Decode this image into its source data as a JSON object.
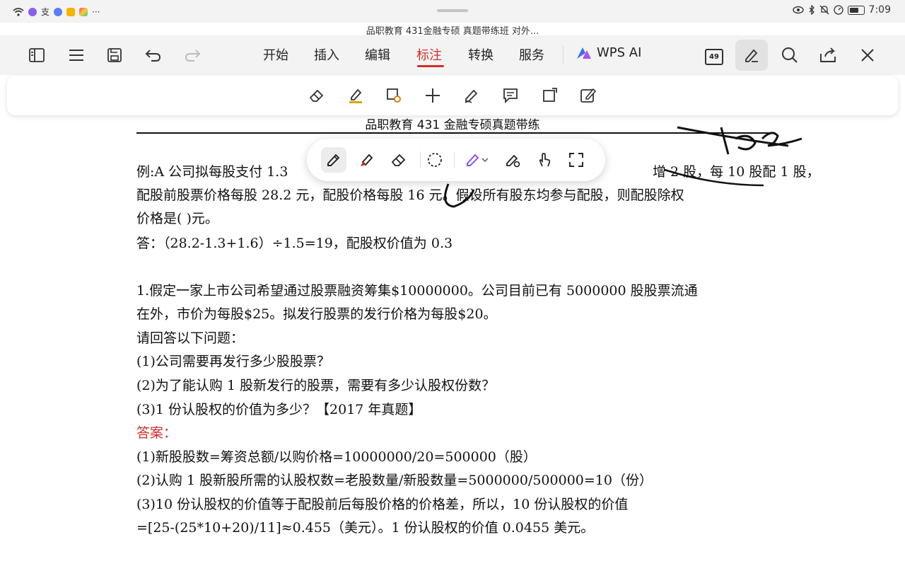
{
  "status": {
    "time": "7:09",
    "left_icons": [
      "wifi-icon",
      "app-icon-purple",
      "alipay-icon",
      "app-icon-blue",
      "app-icon-yellow",
      "gallery-icon",
      "more-dots-icon"
    ],
    "more_dots": "···"
  },
  "doc_title": "品职教育 431金融专硕 真题带练班 对外...",
  "toolbar": {
    "tabs": [
      "开始",
      "插入",
      "编辑",
      "标注",
      "转换",
      "服务"
    ],
    "active_tab": "标注",
    "wps_ai": "WPS AI",
    "page_badge": "49"
  },
  "document": {
    "header": "品职教育 431 金融专硕真题带练",
    "lines": [
      "例:A 公司拟每股支付 1.3",
      "增 2 股，每 10 股配 1 股，",
      "配股前股票价格每股 28.2 元，配股价格每股 16 元。假设所有股东均参与配股，则配股除权",
      "价格是( )元。",
      "答：（28.2-1.3+1.6）÷1.5=19，配股权价值为 0.3",
      "1.假定一家上市公司希望通过股票融资筹集$10000000。公司目前已有 5000000 股股票流通",
      "在外，市价为每股$25。拟发行股票的发行价格为每股$20。",
      "请回答以下问题：",
      "(1)公司需要再发行多少股股票？",
      "(2)为了能认购 1 股新发行的股票，需要有多少认股权份数？",
      "(3)1 份认股权的价值为多少？【2017 年真题】",
      "答案：",
      "(1)新股股数=筹资总额/以购价格=10000000/20=500000（股）",
      "(2)认购 1 股新股所需的认股权数=老股数量/新股数量=5000000/500000=10（份）",
      "(3)10 份认股权的价值等于配股前后每股价格的价格差，所以，10 份认股权的价值",
      "=[25-(25*10+20)/11]≈0.455（美元）。1 份认股权的价值 0.0455 美元。"
    ]
  },
  "colors": {
    "accent_red": "#d0302a",
    "toolbar_bg": "#f3f3f3",
    "ink": "#111111"
  }
}
